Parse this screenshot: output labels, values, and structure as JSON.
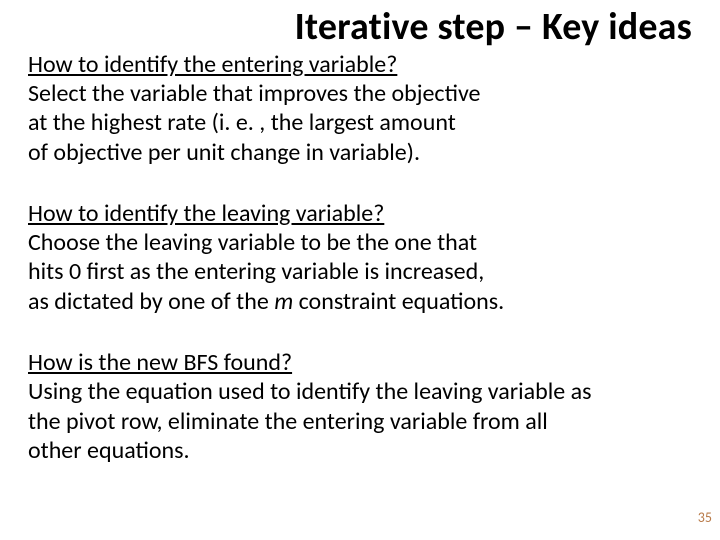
{
  "title": "Iterative step – Key ideas",
  "q1": "How to identify the entering variable?",
  "a1_l1": "Select the variable that improves the objective",
  "a1_l2": "at the highest rate (i. e. , the largest amount",
  "a1_l3": "of objective per unit change in variable).",
  "q2": "How to identify the leaving variable?",
  "a2_l1": "Choose the leaving variable to be the one that",
  "a2_l2": "hits 0 first as the entering variable is increased,",
  "a2_l3_pre": "as dictated by one of the ",
  "a2_l3_m": "m",
  "a2_l3_post": " constraint equations.",
  "q3": "How is the new BFS found?",
  "a3_l1": "Using the equation used to identify the leaving variable as",
  "a3_l2": "the pivot row, eliminate the entering variable from all",
  "a3_l3": "other equations.",
  "page": "35"
}
